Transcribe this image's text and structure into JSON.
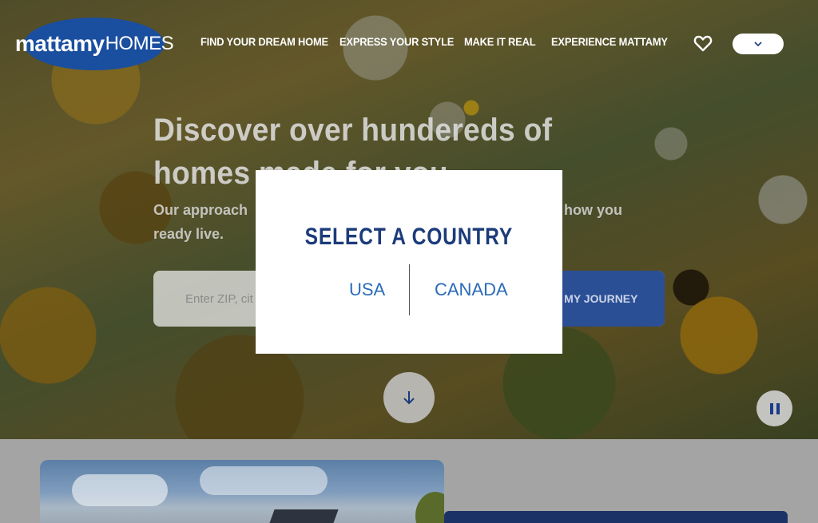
{
  "header": {
    "logo": {
      "part1": "mattamy",
      "part2": "HOMES"
    },
    "nav": [
      {
        "label": "FIND YOUR DREAM HOME"
      },
      {
        "label": "EXPRESS YOUR STYLE"
      },
      {
        "label": "MAKE IT REAL"
      },
      {
        "label": "EXPERIENCE MATTAMY"
      }
    ],
    "favorites_icon": "heart-icon",
    "language_select_icon": "chevron-down-icon"
  },
  "hero": {
    "title": "Discover over hundereds of homes made for you",
    "subtitle_start": "Our approach",
    "subtitle_end": "g how you",
    "subtitle_line2": "ready live.",
    "search": {
      "placeholder": "Enter ZIP, cit",
      "button_label": "ART MY JOURNEY"
    },
    "scroll_icon": "arrow-down-icon",
    "pause_icon": "pause-icon"
  },
  "modal": {
    "title": "SELECT A COUNTRY",
    "options": [
      {
        "label": "USA"
      },
      {
        "label": "CANADA"
      }
    ]
  },
  "colors": {
    "brand_blue": "#1a4e9f",
    "modal_title": "#1b3b7a",
    "country_link": "#2a6bb8",
    "journey_button": "#2b4f95"
  }
}
